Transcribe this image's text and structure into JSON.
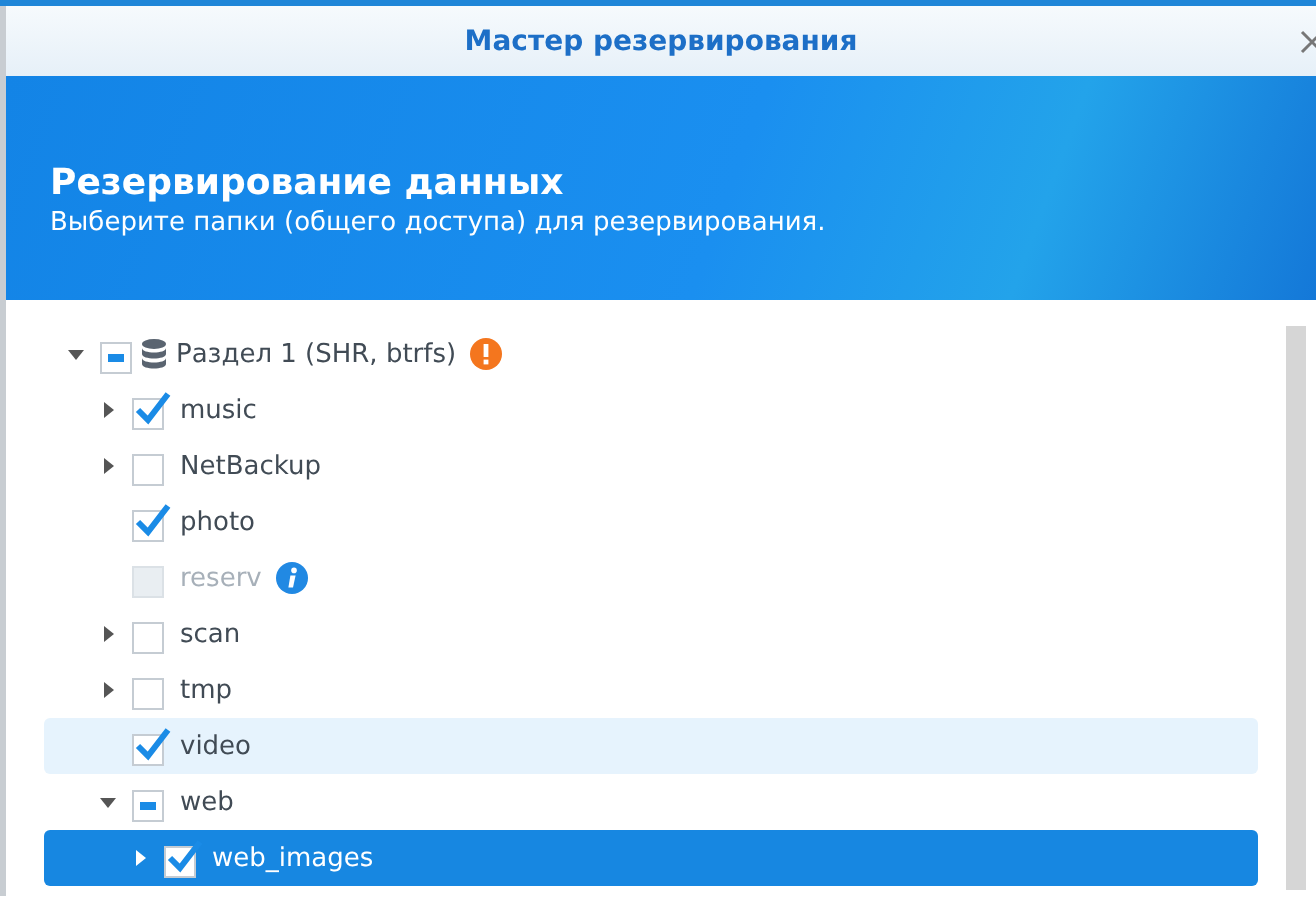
{
  "window": {
    "title": "Мастер резервирования"
  },
  "header": {
    "title": "Резервирование данных",
    "subtitle": "Выберите папки (общего доступа) для резервирования."
  },
  "tree": [
    {
      "kind": "volume",
      "label": "Раздел 1 (SHR, btrfs)",
      "badge": {
        "kind": "warning"
      },
      "checked": true,
      "partial": true,
      "disabled": false,
      "expanded": true,
      "hovered": false,
      "selected": false,
      "children": [
        {
          "label": "music",
          "checked": true,
          "partial": false,
          "disabled": false,
          "expanded": false,
          "hovered": false,
          "selected": false
        },
        {
          "label": "NetBackup",
          "checked": false,
          "partial": false,
          "disabled": false,
          "expanded": false,
          "hovered": false,
          "selected": false
        },
        {
          "label": "photo",
          "checked": true,
          "partial": false,
          "disabled": false,
          "hovered": false,
          "selected": false
        },
        {
          "label": "reserv",
          "badge": {
            "kind": "info"
          },
          "checked": false,
          "partial": false,
          "disabled": true,
          "hovered": false,
          "selected": false
        },
        {
          "label": "scan",
          "checked": false,
          "partial": false,
          "disabled": false,
          "expanded": false,
          "hovered": false,
          "selected": false
        },
        {
          "label": "tmp",
          "checked": false,
          "partial": false,
          "disabled": false,
          "expanded": false,
          "hovered": false,
          "selected": false
        },
        {
          "label": "video",
          "checked": true,
          "partial": false,
          "disabled": false,
          "hovered": true,
          "selected": false
        },
        {
          "label": "web",
          "checked": true,
          "partial": true,
          "disabled": false,
          "expanded": true,
          "hovered": false,
          "selected": false,
          "children": [
            {
              "label": "web_images",
              "checked": true,
              "partial": false,
              "disabled": false,
              "expanded": false,
              "hovered": false,
              "selected": true
            }
          ]
        }
      ]
    }
  ]
}
